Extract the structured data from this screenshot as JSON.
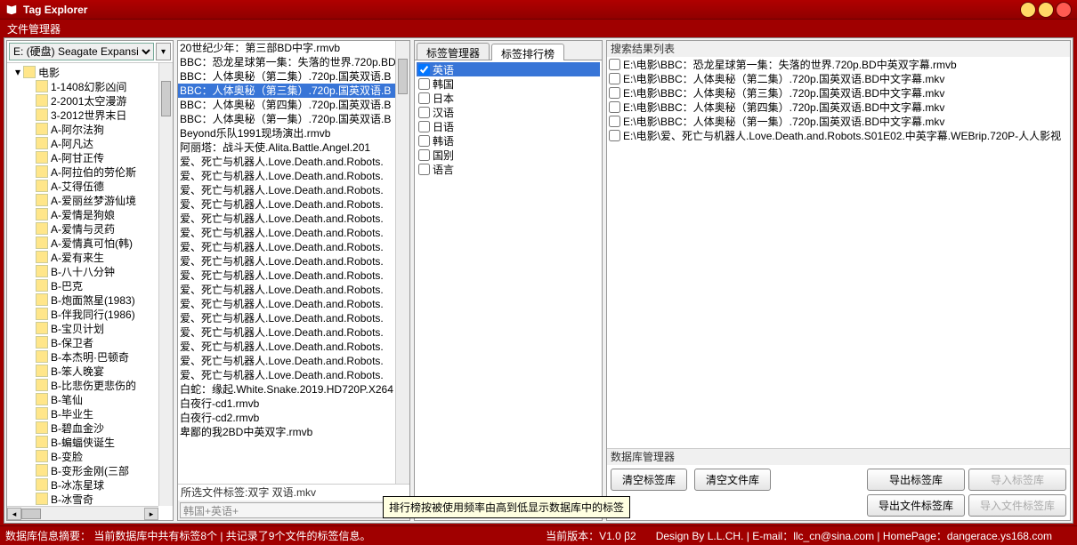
{
  "title": "Tag Explorer",
  "menu": {
    "file_manager": "文件管理器"
  },
  "drive": {
    "selected": "E: (硬盘) Seagate Expansi"
  },
  "tree": {
    "root": "电影",
    "items": [
      "1-1408幻影凶间",
      "2-2001太空漫游",
      "3-2012世界末日",
      "A-阿尔法狗",
      "A-阿凡达",
      "A-阿甘正传",
      "A-阿拉伯的劳伦斯",
      "A-艾得伍德",
      "A-爱丽丝梦游仙境",
      "A-爱情是狗娘",
      "A-爱情与灵药",
      "A-爱情真可怕(韩)",
      "A-爱有来生",
      "B-八十八分钟",
      "B-巴克",
      "B-炮面煞星(1983)",
      "B-伴我同行(1986)",
      "B-宝贝计划",
      "B-保卫者",
      "B-本杰明·巴顿奇",
      "B-笨人晚宴",
      "B-比悲伤更悲伤的",
      "B-笔仙",
      "B-毕业生",
      "B-碧血金沙",
      "B-蝙蝠侠诞生",
      "B-变脸",
      "B-变形金刚(三部",
      "B-冰冻星球",
      "B-冰雪奇"
    ]
  },
  "files": {
    "items": [
      "20世纪少年：第三部BD中字.rmvb",
      "BBC：恐龙星球第一集：失落的世界.720p.BD",
      "BBC：人体奥秘（第二集）.720p.国英双语.B",
      "BBC：人体奥秘（第三集）.720p.国英双语.B",
      "BBC：人体奥秘（第四集）.720p.国英双语.B",
      "BBC：人体奥秘（第一集）.720p.国英双语.B",
      "Beyond乐队1991现场演出.rmvb",
      "阿丽塔：战斗天使.Alita.Battle.Angel.201",
      "爱、死亡与机器人.Love.Death.and.Robots.",
      "爱、死亡与机器人.Love.Death.and.Robots.",
      "爱、死亡与机器人.Love.Death.and.Robots.",
      "爱、死亡与机器人.Love.Death.and.Robots.",
      "爱、死亡与机器人.Love.Death.and.Robots.",
      "爱、死亡与机器人.Love.Death.and.Robots.",
      "爱、死亡与机器人.Love.Death.and.Robots.",
      "爱、死亡与机器人.Love.Death.and.Robots.",
      "爱、死亡与机器人.Love.Death.and.Robots.",
      "爱、死亡与机器人.Love.Death.and.Robots.",
      "爱、死亡与机器人.Love.Death.and.Robots.",
      "爱、死亡与机器人.Love.Death.and.Robots.",
      "爱、死亡与机器人.Love.Death.and.Robots.",
      "爱、死亡与机器人.Love.Death.and.Robots.",
      "爱、死亡与机器人.Love.Death.and.Robots.",
      "爱、死亡与机器人.Love.Death.and.Robots.",
      "白蛇：缘起.White.Snake.2019.HD720P.X264",
      "白夜行-cd1.rmvb",
      "白夜行-cd2.rmvb",
      "卑鄙的我2BD中英双字.rmvb"
    ],
    "selected_index": 3,
    "selected_tags_label": "所选文件标签:",
    "selected_tags_value": "双字 双语.mkv",
    "tag_input_placeholder": "韩国+英语+"
  },
  "tabs": {
    "manage": "标签管理器",
    "rank": "标签排行榜",
    "active": 1
  },
  "tags": {
    "items": [
      "英语",
      "韩国",
      "日本",
      "汉语",
      "日语",
      "韩语",
      "国别",
      "语言"
    ],
    "checked": [
      0
    ],
    "selected": 0
  },
  "results": {
    "label": "搜索结果列表",
    "items": [
      "E:\\电影\\BBC：恐龙星球第一集：失落的世界.720p.BD中英双字幕.rmvb",
      "E:\\电影\\BBC：人体奥秘（第二集）.720p.国英双语.BD中文字幕.mkv",
      "E:\\电影\\BBC：人体奥秘（第三集）.720p.国英双语.BD中文字幕.mkv",
      "E:\\电影\\BBC：人体奥秘（第四集）.720p.国英双语.BD中文字幕.mkv",
      "E:\\电影\\BBC：人体奥秘（第一集）.720p.国英双语.BD中文字幕.mkv",
      "E:\\电影\\爱、死亡与机器人.Love.Death.and.Robots.S01E02.中英字幕.WEBrip.720P-人人影视"
    ]
  },
  "dbmgr": {
    "label": "数据库管理器",
    "clear_tags": "清空标签库",
    "clear_files": "清空文件库",
    "export_tags": "导出标签库",
    "import_tags": "导入标签库",
    "export_file_tags": "导出文件标签库",
    "import_file_tags": "导入文件标签库"
  },
  "tooltip": "排行榜按被使用频率由高到低显示数据库中的标签",
  "status": {
    "summary": "数据库信息摘要：  当前数据库中共有标签8个  |  共记录了9个文件的标签信息。",
    "version": "当前版本：V1.0 β2",
    "design": "Design By L.L.CH. | E-mail：llc_cn@sina.com | HomePage：dangerace.ys168.com"
  }
}
